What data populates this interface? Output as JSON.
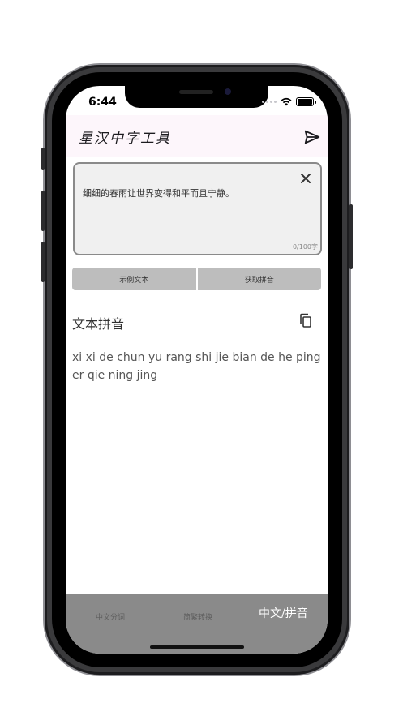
{
  "status_bar": {
    "time": "6:44"
  },
  "app_bar": {
    "title": "星汉中字工具"
  },
  "input": {
    "value": "细细的春雨让世界变得和平而且宁静。",
    "counter": "0/100字"
  },
  "buttons": {
    "sample_text": "示例文本",
    "get_pinyin": "获取拼音"
  },
  "result": {
    "title": "文本拼音",
    "text": "xi xi de chun yu rang shi jie bian de he ping er qie ning jing"
  },
  "bottom_nav": {
    "items": [
      {
        "label": "中文分词"
      },
      {
        "label": "简繁转换"
      },
      {
        "label": "中文/拼音"
      }
    ],
    "active_index": 2
  }
}
